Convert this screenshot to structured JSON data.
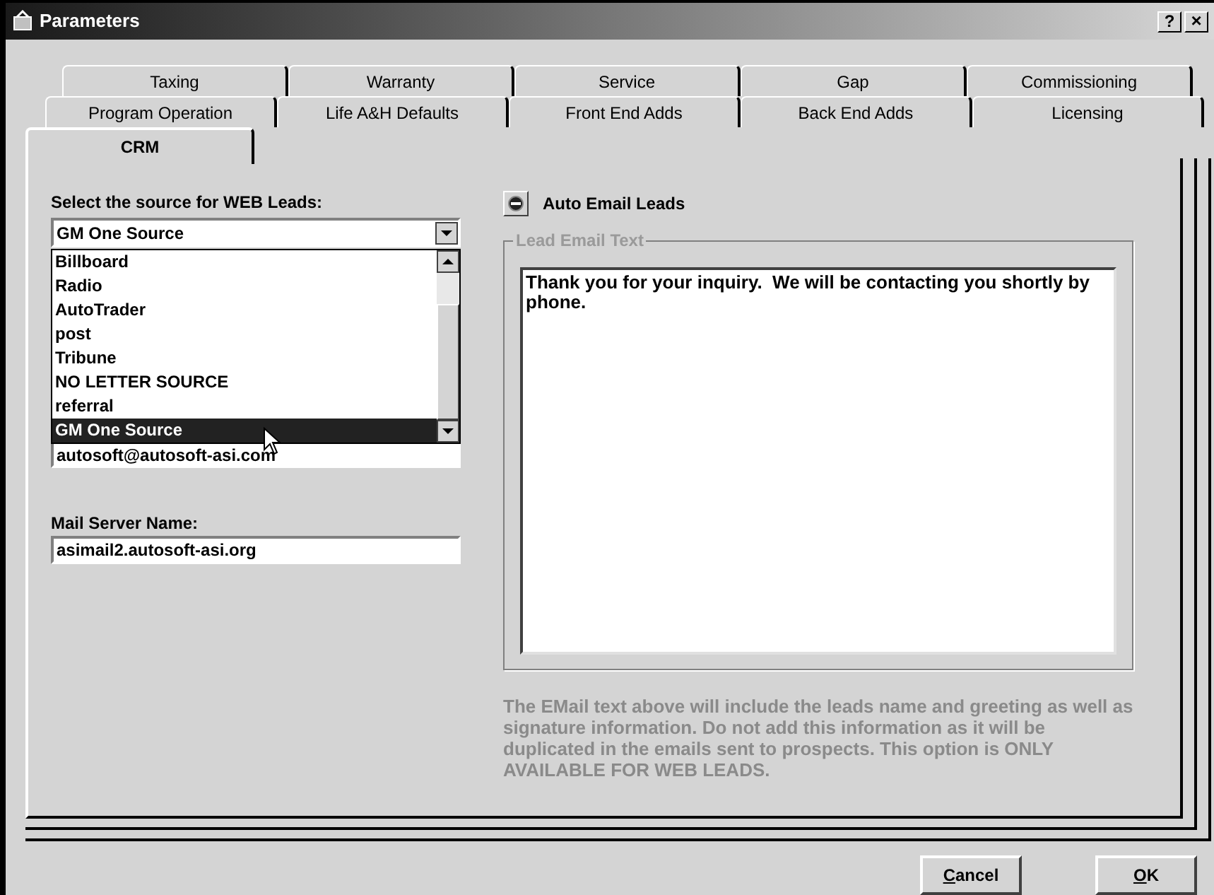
{
  "window": {
    "title": "Parameters",
    "help_button": "?",
    "close_button": "×"
  },
  "tab_rows": [
    [
      {
        "label": "Taxing",
        "selected": false
      },
      {
        "label": "Warranty",
        "selected": false
      },
      {
        "label": "Service",
        "selected": false
      },
      {
        "label": "Gap",
        "selected": false
      },
      {
        "label": "Commissioning",
        "selected": false
      }
    ],
    [
      {
        "label": "Program Operation",
        "selected": false
      },
      {
        "label": "Life A&H Defaults",
        "selected": false
      },
      {
        "label": "Front End Adds",
        "selected": false
      },
      {
        "label": "Back End Adds",
        "selected": false
      },
      {
        "label": "Licensing",
        "selected": false
      }
    ],
    [
      {
        "label": "CRM",
        "selected": true
      }
    ]
  ],
  "source_label": "Select the source for WEB Leads:",
  "source_combo": {
    "value": "GM One Source",
    "options": [
      {
        "label": "Billboard",
        "selected": false
      },
      {
        "label": "Radio",
        "selected": false
      },
      {
        "label": "AutoTrader",
        "selected": false
      },
      {
        "label": "post",
        "selected": false
      },
      {
        "label": "Tribune",
        "selected": false
      },
      {
        "label": "NO LETTER SOURCE",
        "selected": false
      },
      {
        "label": "referral",
        "selected": false
      },
      {
        "label": "GM One Source",
        "selected": true
      }
    ]
  },
  "email_field": {
    "value": "autosoft@autosoft-asi.com"
  },
  "mail_server": {
    "label": "Mail Server Name:",
    "value": "asimail2.autosoft-asi.org"
  },
  "auto_email": {
    "label": "Auto Email Leads"
  },
  "lead_email_group": {
    "title": "Lead Email Text",
    "text": "Thank you for your inquiry.  We will be contacting you shortly by phone."
  },
  "note": "The EMail text above will include the leads name and greeting as well as signature information. Do not add this information as it will be duplicated in the emails sent to prospects. This option is ONLY AVAILABLE FOR WEB LEADS.",
  "buttons": [
    {
      "label": "Cancel"
    },
    {
      "label": "OK"
    }
  ]
}
